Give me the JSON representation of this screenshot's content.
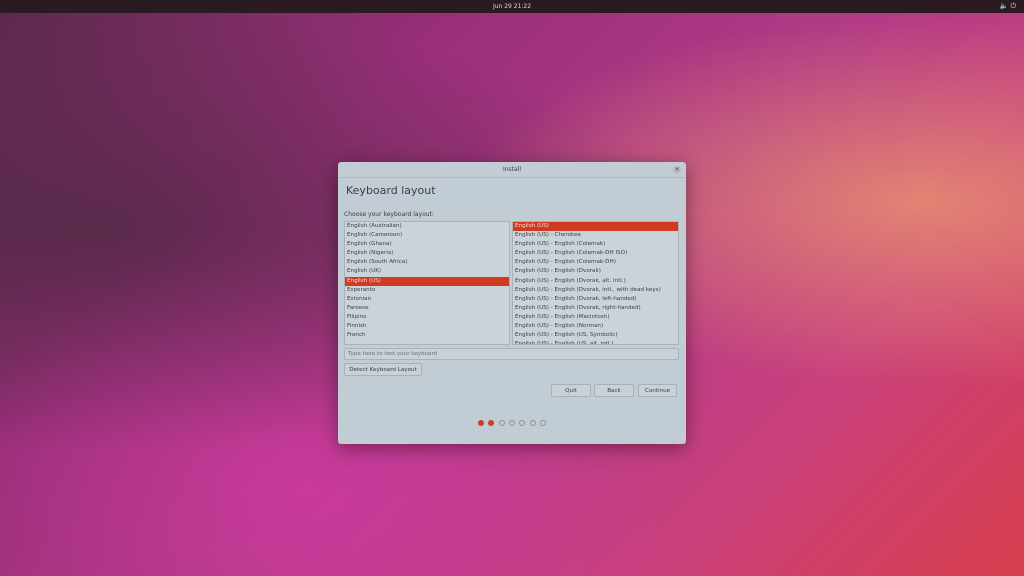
{
  "topbar": {
    "clock": "Jun 29  21:22",
    "system_icon": "speaker-power-icon"
  },
  "window": {
    "title": "Install",
    "close": "×"
  },
  "page": {
    "heading": "Keyboard layout",
    "choose_label": "Choose your keyboard layout:"
  },
  "layouts": [
    "English (Australian)",
    "English (Cameroon)",
    "English (Ghana)",
    "English (Nigeria)",
    "English (South Africa)",
    "English (UK)",
    "English (US)",
    "Esperanto",
    "Estonian",
    "Faroese",
    "Filipino",
    "Finnish",
    "French"
  ],
  "selected_layout_index": 6,
  "variants": [
    "English (US)",
    "English (US) - Cherokee",
    "English (US) - English (Colemak)",
    "English (US) - English (Colemak-DH ISO)",
    "English (US) - English (Colemak-DH)",
    "English (US) - English (Dvorak)",
    "English (US) - English (Dvorak, alt. intl.)",
    "English (US) - English (Dvorak, intl., with dead keys)",
    "English (US) - English (Dvorak, left-handed)",
    "English (US) - English (Dvorak, right-handed)",
    "English (US) - English (Macintosh)",
    "English (US) - English (Norman)",
    "English (US) - English (US, Symbolic)",
    "English (US) - English (US, alt. intl.)"
  ],
  "selected_variant_index": 0,
  "test_input": {
    "placeholder": "Type here to test your keyboard"
  },
  "buttons": {
    "detect": "Detect Keyboard Layout",
    "quit": "Quit",
    "back": "Back",
    "continue": "Continue"
  },
  "progress": {
    "total_steps": 7,
    "completed_steps": 2
  },
  "colors": {
    "accent": "#d03a1e"
  }
}
